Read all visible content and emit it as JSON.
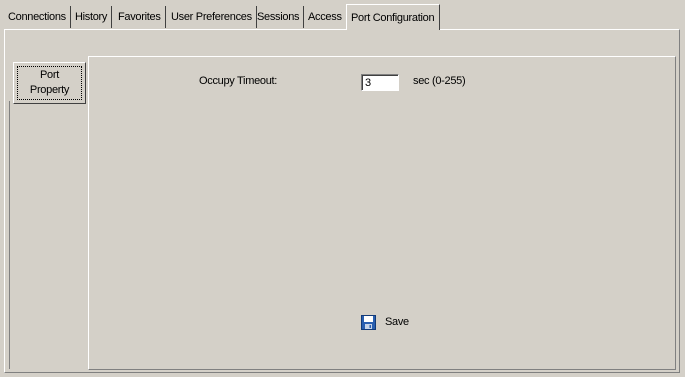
{
  "tabs": [
    {
      "label": "Connections"
    },
    {
      "label": "History"
    },
    {
      "label": "Favorites"
    },
    {
      "label": "User Preferences"
    },
    {
      "label": "Sessions"
    },
    {
      "label": "Access"
    },
    {
      "label": "Port Configuration",
      "active": true
    }
  ],
  "side_tab": {
    "line1": "Port",
    "line2": "Property"
  },
  "occupy_timeout": {
    "label": "Occupy Timeout:",
    "value": "3",
    "unit": "sec (0-255)"
  },
  "save": {
    "label": "Save",
    "icon": "floppy-disk-icon"
  },
  "colors": {
    "background": "#d4d0c8",
    "save_icon": "#2a5fb0"
  }
}
